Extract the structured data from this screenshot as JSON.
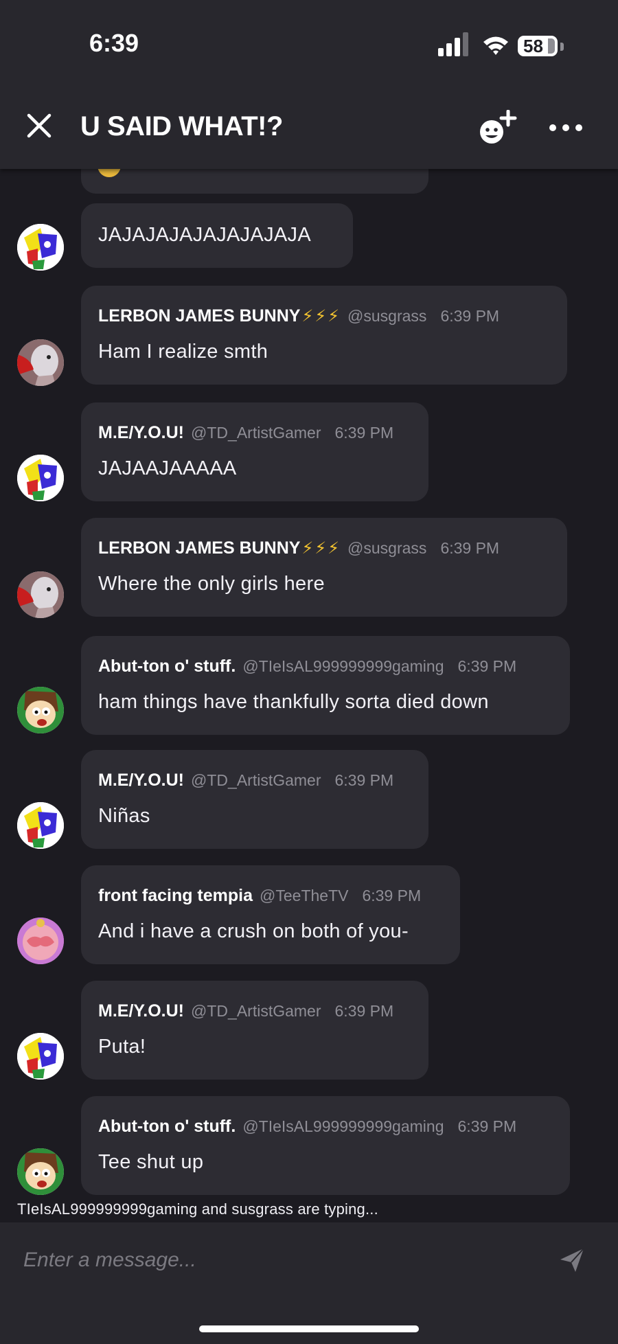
{
  "status_bar": {
    "time": "6:39",
    "battery": "58",
    "icons": [
      "signal-icon",
      "wifi-icon",
      "battery-icon"
    ]
  },
  "header": {
    "title": "U SAID WHAT!?",
    "icons": [
      "close-icon",
      "add-member-icon",
      "more-icon"
    ]
  },
  "messages": [
    {
      "text": "JAJAJAJAJAJAJAJAJA"
    },
    {
      "name": "LERBON JAMES BUNNY",
      "badges": "⚡⚡⚡",
      "handle": "@susgrass",
      "time": "6:39 PM",
      "text": "Ham I realize smth"
    },
    {
      "name": "M.E/Y.O.U!",
      "handle": "@TD_ArtistGamer",
      "time": "6:39 PM",
      "text": "JAJAAJAAAAA"
    },
    {
      "name": "LERBON JAMES BUNNY",
      "badges": "⚡⚡⚡",
      "handle": "@susgrass",
      "time": "6:39 PM",
      "text": "Where the only girls here"
    },
    {
      "name": "Abut-ton o' stuff.",
      "handle": "@TIeIsAL999999999gaming",
      "time": "6:39 PM",
      "text": "ham things have thankfully sorta died down"
    },
    {
      "name": "M.E/Y.O.U!",
      "handle": "@TD_ArtistGamer",
      "time": "6:39 PM",
      "text": "Niñas"
    },
    {
      "name": "front facing tempia",
      "handle": "@TeeTheTV",
      "time": "6:39 PM",
      "text": "And i have a crush on both of you-"
    },
    {
      "name": "M.E/Y.O.U!",
      "handle": "@TD_ArtistGamer",
      "time": "6:39 PM",
      "text": "Puta!"
    },
    {
      "name": "Abut-ton o' stuff.",
      "handle": "@TIeIsAL999999999gaming",
      "time": "6:39 PM",
      "text": "Tee shut up"
    }
  ],
  "typing_indicator": "TIeIsAL999999999gaming and susgrass are typing...",
  "composer": {
    "placeholder": "Enter a message...",
    "icons": [
      "send-icon"
    ]
  },
  "colors": {
    "background": "#1c1b21",
    "header": "#28272d",
    "bubble": "#2d2c33",
    "muted_text": "#8f8e96",
    "bolt": "#f4c430"
  }
}
